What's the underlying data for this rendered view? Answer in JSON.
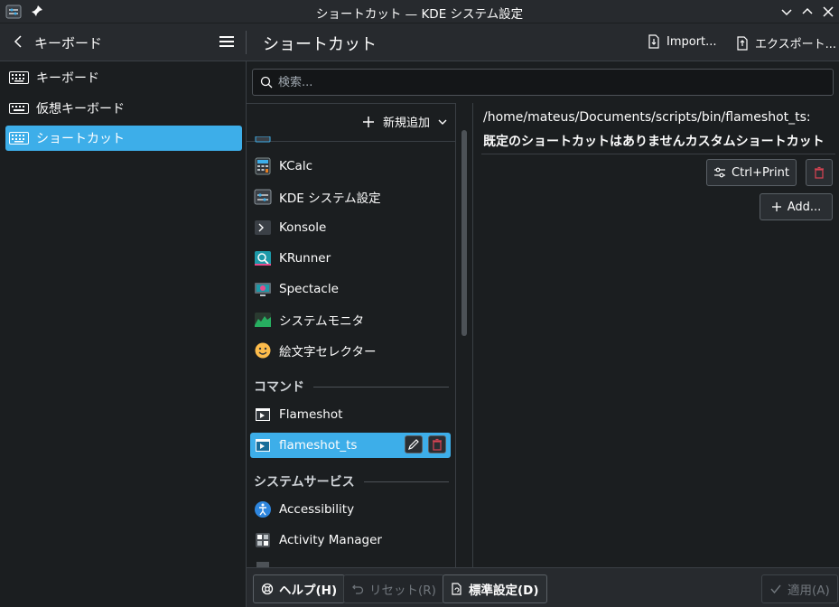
{
  "window": {
    "title": "ショートカット — KDE システム設定"
  },
  "left_header": {
    "breadcrumb": "キーボード"
  },
  "right_header": {
    "page_title": "ショートカット",
    "import_label": "Import...",
    "export_label": "エクスポート..."
  },
  "sidebar": {
    "items": [
      {
        "label": "キーボード",
        "icon": "keyboard-icon"
      },
      {
        "label": "仮想キーボード",
        "icon": "virtual-keyboard-icon"
      },
      {
        "label": "ショートカット",
        "icon": "keyboard-icon",
        "active": true
      }
    ]
  },
  "search": {
    "placeholder": "検索..."
  },
  "list": {
    "add_new_label": "新規追加",
    "apps": [
      {
        "label": "KCalc",
        "icon": "kcalc-icon"
      },
      {
        "label": "KDE システム設定",
        "icon": "system-settings-icon"
      },
      {
        "label": "Konsole",
        "icon": "konsole-icon"
      },
      {
        "label": "KRunner",
        "icon": "krunner-icon"
      },
      {
        "label": "Spectacle",
        "icon": "spectacle-icon"
      },
      {
        "label": "システムモニタ",
        "icon": "system-monitor-icon"
      },
      {
        "label": "絵文字セレクター",
        "icon": "emoji-icon"
      }
    ],
    "commands_header": "コマンド",
    "commands": [
      {
        "label": "Flameshot",
        "icon": "command-icon"
      },
      {
        "label": "flameshot_ts",
        "icon": "command-icon",
        "selected": true
      }
    ],
    "services_header": "システムサービス",
    "services": [
      {
        "label": "Accessibility",
        "icon": "accessibility-icon"
      },
      {
        "label": "Activity Manager",
        "icon": "activity-manager-icon"
      }
    ]
  },
  "detail": {
    "path": "/home/mateus/Documents/scripts/bin/flameshot_ts:",
    "note": "既定のショートカットはありませんカスタムショートカット",
    "shortcut": "Ctrl+Print",
    "add_label": "Add..."
  },
  "footer": {
    "help": "ヘルプ(H)",
    "reset": "リセット(R)",
    "defaults": "標準設定(D)",
    "apply": "適用(A)"
  },
  "colors": {
    "accent": "#3daee9",
    "background": "#1b1e20",
    "header": "#272a2e",
    "delete": "#da4453"
  }
}
